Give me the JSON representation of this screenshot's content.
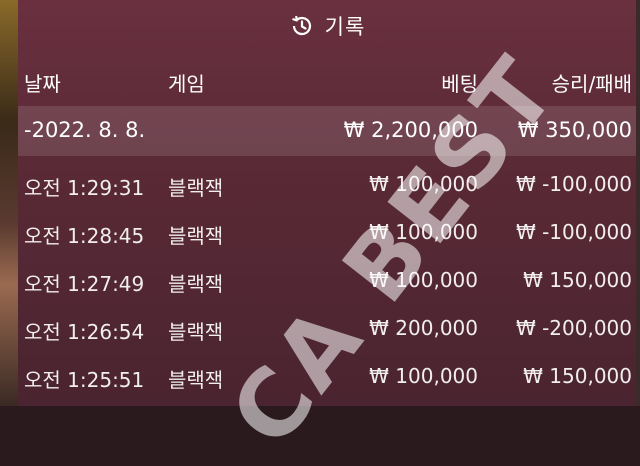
{
  "header": {
    "title": "기록",
    "icon": "history-icon"
  },
  "columns": {
    "date": "날짜",
    "game": "게임",
    "bet": "베팅",
    "win_loss": "승리/패배"
  },
  "summary": {
    "date": "-2022. 8. 8.",
    "bet": "₩ 2,200,000",
    "win_loss": "₩ 350,000"
  },
  "rows": [
    {
      "time": "오전 1:29:31",
      "game": "블랙잭",
      "bet": "₩ 100,000",
      "win_loss": "₩ -100,000"
    },
    {
      "time": "오전 1:28:45",
      "game": "블랙잭",
      "bet": "₩ 100,000",
      "win_loss": "₩ -100,000"
    },
    {
      "time": "오전 1:27:49",
      "game": "블랙잭",
      "bet": "₩ 100,000",
      "win_loss": "₩ 150,000"
    },
    {
      "time": "오전 1:26:54",
      "game": "블랙잭",
      "bet": "₩ 200,000",
      "win_loss": "₩ -200,000"
    },
    {
      "time": "오전 1:25:51",
      "game": "블랙잭",
      "bet": "₩ 100,000",
      "win_loss": "₩ 150,000"
    }
  ],
  "watermark": "CA BEST",
  "colors": {
    "panel": "#5a2a36",
    "summary_row": "#7a4a56"
  }
}
